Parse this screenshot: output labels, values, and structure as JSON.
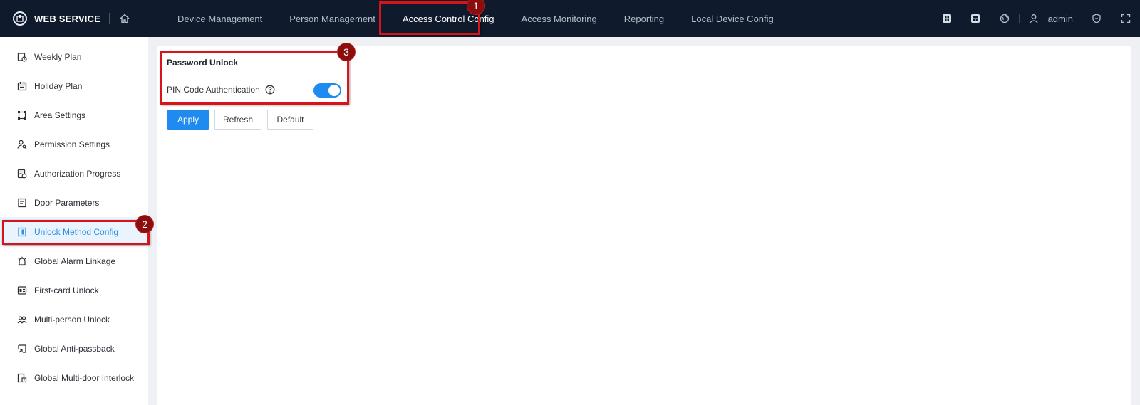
{
  "app": {
    "title": "WEB SERVICE"
  },
  "nav": {
    "items": [
      {
        "label": "Device Management"
      },
      {
        "label": "Person Management"
      },
      {
        "label": "Access Control Config",
        "active": true
      },
      {
        "label": "Access Monitoring"
      },
      {
        "label": "Reporting"
      },
      {
        "label": "Local Device Config"
      }
    ]
  },
  "user": {
    "name": "admin"
  },
  "sidebar": {
    "items": [
      {
        "label": "Weekly Plan",
        "icon": "weekly-plan-icon"
      },
      {
        "label": "Holiday Plan",
        "icon": "calendar-icon"
      },
      {
        "label": "Area Settings",
        "icon": "area-icon"
      },
      {
        "label": "Permission Settings",
        "icon": "person-key-icon"
      },
      {
        "label": "Authorization Progress",
        "icon": "progress-doc-icon"
      },
      {
        "label": "Door Parameters",
        "icon": "door-params-icon"
      },
      {
        "label": "Unlock Method Config",
        "icon": "unlock-method-icon",
        "active": true
      },
      {
        "label": "Global Alarm Linkage",
        "icon": "alarm-icon"
      },
      {
        "label": "First-card Unlock",
        "icon": "card-icon"
      },
      {
        "label": "Multi-person Unlock",
        "icon": "multi-person-icon"
      },
      {
        "label": "Global Anti-passback",
        "icon": "anti-passback-icon"
      },
      {
        "label": "Global Multi-door Interlock",
        "icon": "interlock-icon"
      }
    ]
  },
  "main": {
    "section_title": "Password Unlock",
    "pin_label": "PIN Code Authentication",
    "pin_enabled": true,
    "buttons": {
      "apply": "Apply",
      "refresh": "Refresh",
      "default": "Default"
    }
  },
  "annotations": {
    "badge1": "1",
    "badge2": "2",
    "badge3": "3"
  },
  "colors": {
    "topbar": "#0f1b2d",
    "accent": "#1f8bf0",
    "annotation": "#d7141a",
    "badge": "#8b0d0d"
  }
}
